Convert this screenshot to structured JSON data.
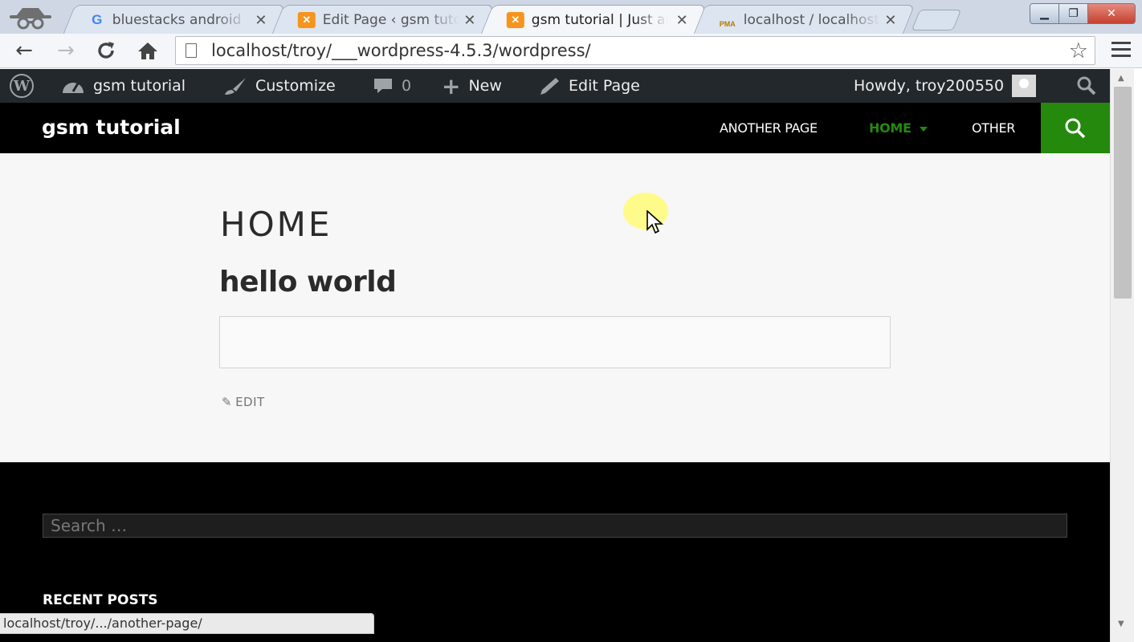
{
  "browser": {
    "tabs": [
      {
        "label": "bluestacks android",
        "favicon": "google-icon",
        "favicon_text": "G",
        "active": false
      },
      {
        "label": "Edit Page ‹ gsm tutorial",
        "favicon": "xampp-icon",
        "active": false
      },
      {
        "label": "gsm tutorial | Just another",
        "favicon": "xampp-icon",
        "active": true
      },
      {
        "label": "localhost / localhost",
        "favicon": "phpmyadmin-icon",
        "favicon_text": "PMA",
        "active": false
      }
    ],
    "close_glyph": "✕",
    "url": "localhost/troy/___wordpress-4.5.3/wordpress/",
    "status_url": "localhost/troy/.../another-page/"
  },
  "admin_bar": {
    "site_name": "gsm tutorial",
    "customize": "Customize",
    "comments_count": "0",
    "new": "New",
    "edit_page": "Edit Page",
    "howdy": "Howdy, troy200550"
  },
  "site": {
    "title": "gsm tutorial",
    "nav": [
      {
        "label": "Another Page",
        "current": false
      },
      {
        "label": "Home",
        "current": true
      },
      {
        "label": "Other",
        "current": false
      }
    ]
  },
  "page": {
    "title": "HOME",
    "heading": "hello world",
    "edit_label": "EDIT"
  },
  "footer": {
    "search_placeholder": "Search …",
    "widget_title": "RECENT POSTS"
  },
  "colors": {
    "admin_bar": "#23282d",
    "accent_green": "#24890d",
    "header": "#000000"
  }
}
